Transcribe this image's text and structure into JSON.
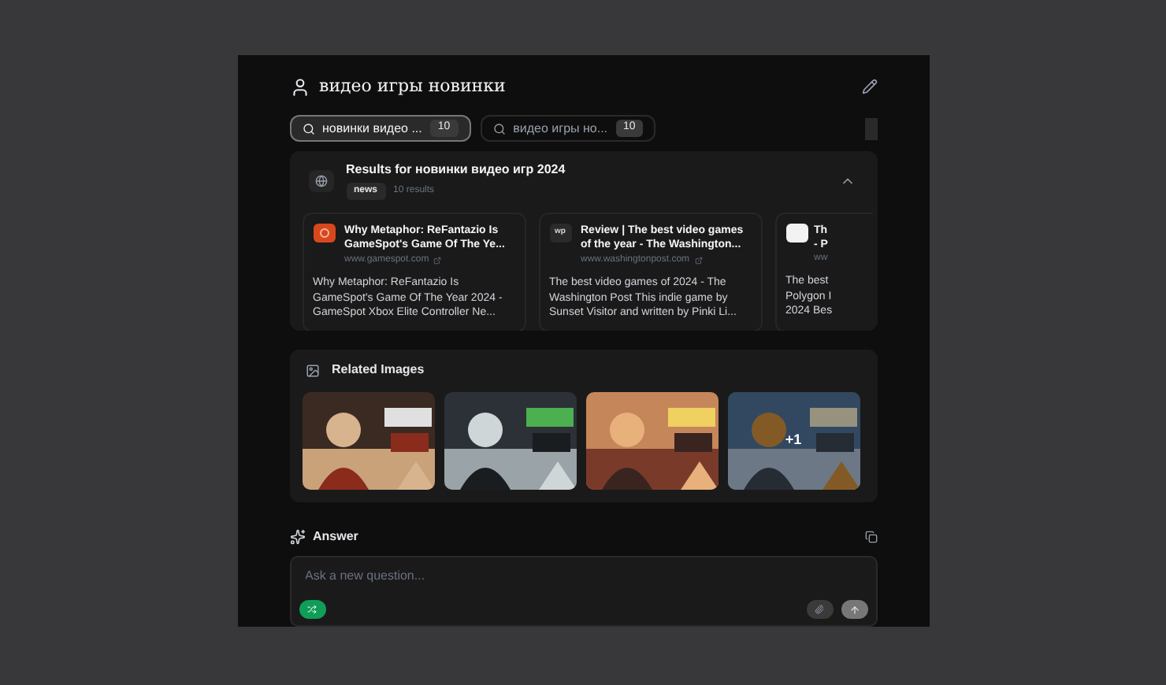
{
  "header": {
    "title": "видео игры новинки"
  },
  "query_tabs": [
    {
      "label": "новинки видео ...",
      "count": "10",
      "selected": true
    },
    {
      "label": "видео игры но...",
      "count": "10",
      "selected": false
    }
  ],
  "results": {
    "title": "Results for новинки видео игр 2024",
    "tag": "news",
    "count": "10 results",
    "expanded": true,
    "cards": [
      {
        "title": "Why Metaphor: ReFantazio Is GameSpot's Game Of The Ye...",
        "site": "www.gamespot.com",
        "snippet": "Why Metaphor: ReFantazio Is GameSpot's Game Of The Year 2024 - GameSpot Xbox Elite Controller Ne...",
        "color": "#d9481c"
      },
      {
        "title": "Review | The best video games of the year - The Washington...",
        "site": "www.washingtonpost.com",
        "snippet": "The best video games of 2024 - The Washington Post This indie game by Sunset Visitor and written by Pinki Li...",
        "color": "#2a2a2a",
        "logo": "wp"
      },
      {
        "kind": "partial",
        "title_lines": [
          "Th",
          "- P"
        ],
        "site": "ww",
        "snippet_lines": [
          "The best",
          "Polygon I",
          "2024 Bes"
        ],
        "color": "#f2f2f2"
      }
    ]
  },
  "related_images": {
    "title": "Related Images",
    "images": [
      {
        "kind": "picture"
      },
      {
        "kind": "picture"
      },
      {
        "kind": "picture"
      },
      {
        "kind": "picture",
        "more": "+1"
      }
    ]
  },
  "answer": {
    "title": "Answer"
  },
  "ask": {
    "placeholder": "Ask a new question..."
  }
}
